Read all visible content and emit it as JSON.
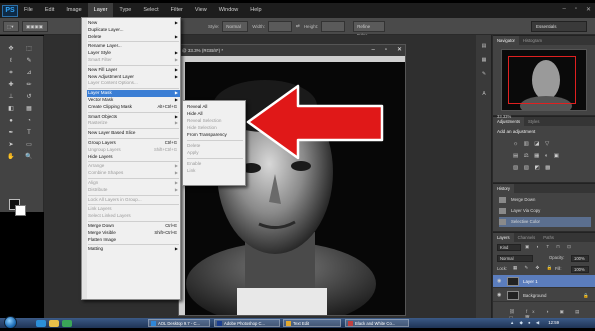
{
  "app": {
    "logo": "PS"
  },
  "menubar": {
    "items": [
      "File",
      "Edit",
      "Image",
      "Layer",
      "Type",
      "Select",
      "Filter",
      "View",
      "Window",
      "Help"
    ],
    "active_index": 3
  },
  "optionsbar": {
    "mode": "Normal",
    "width_label": "Width:",
    "height_label": "Height:",
    "refine": "Refine Edge...",
    "workspace": "Essentials"
  },
  "document": {
    "title": "@ 33.3% (RGB/8*) *"
  },
  "layer_menu": {
    "items": [
      {
        "label": "New",
        "disabled": false,
        "submenu": true
      },
      {
        "label": "Duplicate Layer...",
        "disabled": false
      },
      {
        "label": "Delete",
        "disabled": false,
        "submenu": true
      },
      {
        "sep": true
      },
      {
        "label": "Rename Layer...",
        "disabled": false
      },
      {
        "label": "Layer Style",
        "disabled": false,
        "submenu": true
      },
      {
        "label": "Smart Filter",
        "disabled": true,
        "submenu": true
      },
      {
        "sep": true
      },
      {
        "label": "New Fill Layer",
        "disabled": false,
        "submenu": true
      },
      {
        "label": "New Adjustment Layer",
        "disabled": false,
        "submenu": true
      },
      {
        "label": "Layer Content Options...",
        "disabled": true
      },
      {
        "sep": true
      },
      {
        "label": "Layer Mask",
        "disabled": false,
        "submenu": true,
        "highlighted": true
      },
      {
        "label": "Vector Mask",
        "disabled": false,
        "submenu": true
      },
      {
        "label": "Create Clipping Mask",
        "disabled": false,
        "shortcut": "Alt+Ctrl+G"
      },
      {
        "sep": true
      },
      {
        "label": "Smart Objects",
        "disabled": false,
        "submenu": true
      },
      {
        "label": "Rasterize",
        "disabled": true,
        "submenu": true
      },
      {
        "sep": true
      },
      {
        "label": "New Layer Based Slice",
        "disabled": false
      },
      {
        "sep": true
      },
      {
        "label": "Group Layers",
        "disabled": false,
        "shortcut": "Ctrl+G"
      },
      {
        "label": "Ungroup Layers",
        "disabled": true,
        "shortcut": "Shift+Ctrl+G"
      },
      {
        "label": "Hide Layers",
        "disabled": false
      },
      {
        "sep": true
      },
      {
        "label": "Arrange",
        "disabled": true,
        "submenu": true
      },
      {
        "label": "Combine Shapes",
        "disabled": true,
        "submenu": true
      },
      {
        "sep": true
      },
      {
        "label": "Align",
        "disabled": true,
        "submenu": true
      },
      {
        "label": "Distribute",
        "disabled": true,
        "submenu": true
      },
      {
        "sep": true
      },
      {
        "label": "Lock All Layers in Group...",
        "disabled": true
      },
      {
        "sep": true
      },
      {
        "label": "Link Layers",
        "disabled": true
      },
      {
        "label": "Select Linked Layers",
        "disabled": true
      },
      {
        "sep": true
      },
      {
        "label": "Merge Down",
        "disabled": false,
        "shortcut": "Ctrl+E"
      },
      {
        "label": "Merge Visible",
        "disabled": false,
        "shortcut": "Shift+Ctrl+E"
      },
      {
        "label": "Flatten Image",
        "disabled": false
      },
      {
        "sep": true
      },
      {
        "label": "Matting",
        "disabled": false,
        "submenu": true
      }
    ]
  },
  "layer_mask_submenu": {
    "items": [
      {
        "label": "Reveal All",
        "disabled": false
      },
      {
        "label": "Hide All",
        "disabled": false
      },
      {
        "label": "Reveal Selection",
        "disabled": true
      },
      {
        "label": "Hide Selection",
        "disabled": true
      },
      {
        "label": "From Transparency",
        "disabled": false
      },
      {
        "sep": true
      },
      {
        "label": "Delete",
        "disabled": true
      },
      {
        "label": "Apply",
        "disabled": true
      },
      {
        "sep": true
      },
      {
        "label": "Enable",
        "disabled": true
      },
      {
        "label": "Link",
        "disabled": true
      }
    ]
  },
  "panels": {
    "navigator_tabs": [
      "Navigator",
      "Histogram"
    ],
    "nav_zoom": "33.33%",
    "adjust_tabs": [
      "Adjustments",
      "Styles"
    ],
    "adjust_title": "Add an adjustment",
    "adjust_icons_row1": "☼ ▥ ◪ ▽",
    "adjust_icons_row2": "▤ ⚖ ▦ ◐ ▣",
    "adjust_icons_row3": "▨ ▧ ◩ ▩",
    "history_tabs": [
      "History"
    ],
    "history_items": [
      {
        "label": "Merge Down",
        "selected": false
      },
      {
        "label": "Layer Via Copy",
        "selected": false
      },
      {
        "label": "Selective Color",
        "selected": true
      }
    ],
    "layers_tabs": [
      "Layers",
      "Channels",
      "Paths"
    ],
    "kind_label": "Kind",
    "blend_mode": "Normal",
    "opacity_label": "Opacity:",
    "opacity_value": "100%",
    "lock_label": "Lock:",
    "fill_label": "Fill:",
    "fill_value": "100%",
    "layers": [
      {
        "name": "Layer 1",
        "selected": true
      },
      {
        "name": "Background",
        "selected": false,
        "locked": true
      }
    ]
  },
  "taskbar": {
    "tasks": [
      "AOL Desktop 9.7 - C...",
      "Adobe Photoshop C...",
      "Text Edit",
      "Black and White Co..."
    ],
    "clock": "12:59"
  },
  "colors": {
    "highlight": "#3b7ed4",
    "arrow": "#e01818"
  }
}
